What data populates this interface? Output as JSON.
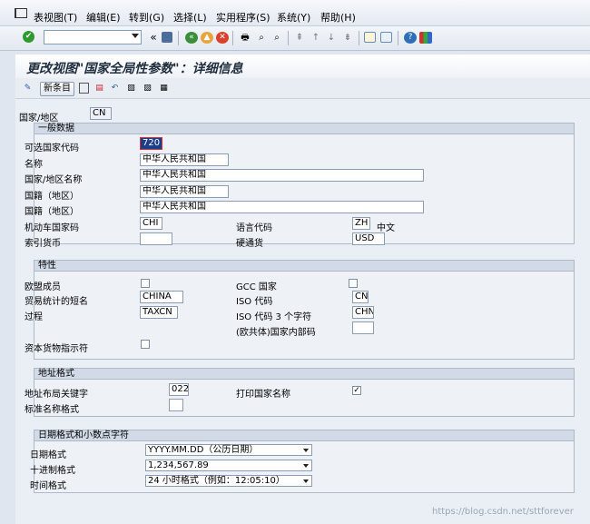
{
  "menu": [
    "表视图(T)",
    "编辑(E)",
    "转到(G)",
    "选择(L)",
    "实用程序(S)",
    "系统(Y)",
    "帮助(H)"
  ],
  "title": "更改视图\"国家全局性参数\"：详细信息",
  "new_entries_label": "新条目",
  "country": {
    "label": "国家/地区",
    "value": "CN"
  },
  "general": {
    "header": "一般数据",
    "alt_code_label": "可选国家代码",
    "alt_code": "720",
    "name_label": "名称",
    "name": "中华人民共和国",
    "country_name_label": "国家/地区名称",
    "country_name": "中华人民共和国",
    "nationality1_label": "国籍（地区）",
    "nationality1": "中华人民共和国",
    "nationality2_label": "国籍（地区）",
    "nationality2": "中华人民共和国",
    "vehicle_label": "机动车国家码",
    "vehicle": "CHI",
    "lang_label": "语言代码",
    "lang": "ZH",
    "lang_text": "中文",
    "index_curr_label": "索引货币",
    "index_curr": "",
    "hard_curr_label": "硬通货",
    "hard_curr": "USD"
  },
  "properties": {
    "header": "特性",
    "eu_label": "欧盟成员",
    "eu_checked": false,
    "gcc_label": "GCC 国家",
    "gcc_checked": false,
    "trade_label": "贸易统计的短名",
    "trade": "CHINA",
    "iso_label": "ISO 代码",
    "iso": "CN",
    "procedure_label": "过程",
    "procedure": "TAXCN",
    "iso3_label": "ISO 代码 3 个字符",
    "iso3": "CHN",
    "eu_internal_label": "(欧共体)国家内部码",
    "eu_internal": "",
    "capital_label": "资本货物指示符",
    "capital_checked": false
  },
  "address": {
    "header": "地址格式",
    "layout_key_label": "地址布局关键字",
    "layout_key": "022",
    "print_country_label": "打印国家名称",
    "print_country_checked": true,
    "std_name_label": "标准名称格式",
    "std_name": ""
  },
  "date": {
    "header": "日期格式和小数点字符",
    "date_fmt_label": "日期格式",
    "date_fmt": "YYYY.MM.DD（公历日期）",
    "decimal_label": "十进制格式",
    "decimal": "1,234,567.89",
    "time_label": "时间格式",
    "time": "24 小时格式（例如：12:05:10）"
  },
  "watermark": "https://blog.csdn.net/sttforever",
  "icons": [
    "menu-app-icon",
    "ok-icon",
    "back-icon",
    "save-icon",
    "exit-icon",
    "cancel-icon",
    "print-icon",
    "find-icon",
    "find-next-icon",
    "first-page-icon",
    "prev-page-icon",
    "next-page-icon",
    "last-page-icon",
    "create-session-icon",
    "shortcut-icon",
    "help-icon",
    "layout-icon",
    "display-change-icon",
    "copy-as-icon",
    "delete-icon",
    "undo-icon",
    "select-all-icon",
    "select-block-icon",
    "deselect-icon"
  ],
  "colors": {
    "ok": "#2e9a2e",
    "cancel": "#d9412b",
    "exit": "#e8a33a",
    "focus": "#1c3d8a"
  }
}
